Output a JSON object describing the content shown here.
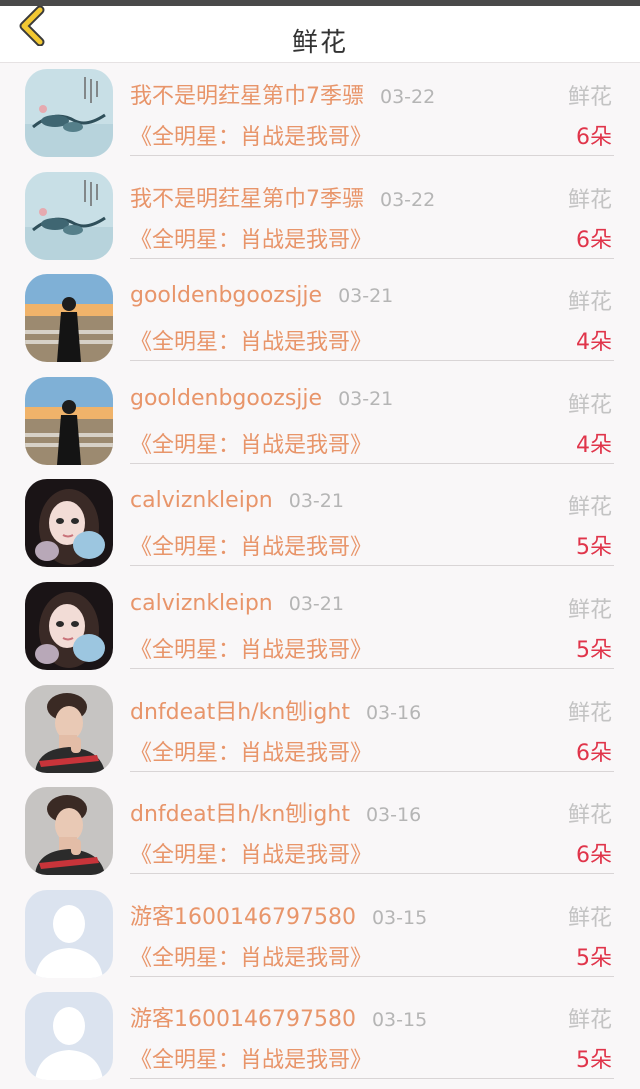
{
  "header": {
    "title": "鲜花"
  },
  "colors": {
    "accent_name": "#e8956a",
    "count_red": "#e0344a",
    "back_arrow": "#f2c832"
  },
  "rows": [
    {
      "avatar": "ink-painting-avatar",
      "name": "我不是明荭星第巾7季骠",
      "date": "03-22",
      "label": "鲜花",
      "subject": "《全明星：肖战是我哥》",
      "count": "6朵"
    },
    {
      "avatar": "ink-painting-avatar",
      "name": "我不是明荭星第巾7季骠",
      "date": "03-22",
      "label": "鲜花",
      "subject": "《全明星：肖战是我哥》",
      "count": "6朵"
    },
    {
      "avatar": "beach-girl-avatar",
      "name": "gooldenbgoozsjje",
      "date": "03-21",
      "label": "鲜花",
      "subject": "《全明星：肖战是我哥》",
      "count": "4朵"
    },
    {
      "avatar": "beach-girl-avatar",
      "name": "gooldenbgoozsjje",
      "date": "03-21",
      "label": "鲜花",
      "subject": "《全明星：肖战是我哥》",
      "count": "4朵"
    },
    {
      "avatar": "doll-girl-avatar",
      "name": "calviznkleipn",
      "date": "03-21",
      "label": "鲜花",
      "subject": "《全明星：肖战是我哥》",
      "count": "5朵"
    },
    {
      "avatar": "doll-girl-avatar",
      "name": "calviznkleipn",
      "date": "03-21",
      "label": "鲜花",
      "subject": "《全明星：肖战是我哥》",
      "count": "5朵"
    },
    {
      "avatar": "boy-avatar",
      "name": "dnfdeat目h/kn刨ight",
      "date": "03-16",
      "label": "鲜花",
      "subject": "《全明星：肖战是我哥》",
      "count": "6朵"
    },
    {
      "avatar": "boy-avatar",
      "name": "dnfdeat目h/kn刨ight",
      "date": "03-16",
      "label": "鲜花",
      "subject": "《全明星：肖战是我哥》",
      "count": "6朵"
    },
    {
      "avatar": "default-user-avatar",
      "name": "游客1600146797580",
      "date": "03-15",
      "label": "鲜花",
      "subject": "《全明星：肖战是我哥》",
      "count": "5朵"
    },
    {
      "avatar": "default-user-avatar",
      "name": "游客1600146797580",
      "date": "03-15",
      "label": "鲜花",
      "subject": "《全明星：肖战是我哥》",
      "count": "5朵"
    }
  ]
}
